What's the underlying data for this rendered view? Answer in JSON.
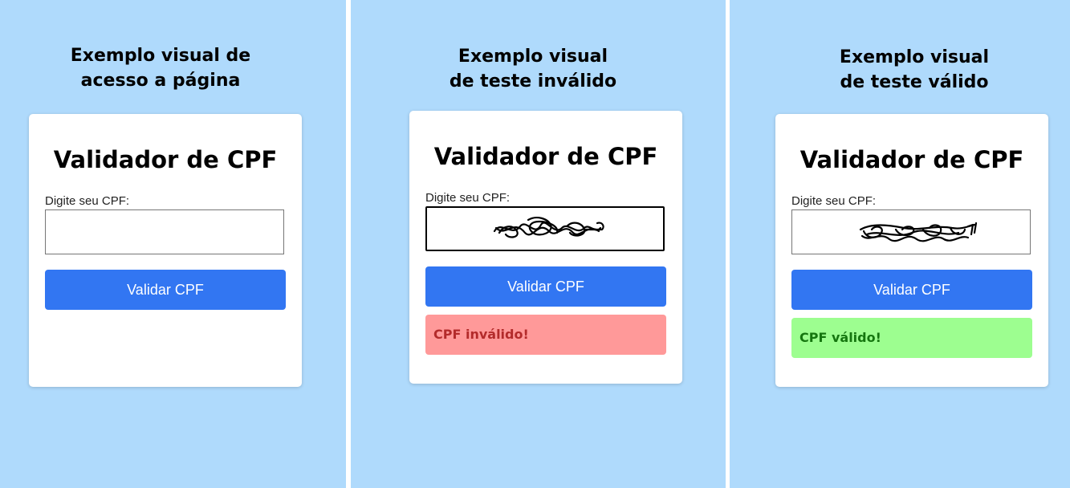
{
  "panels": [
    {
      "caption_lines": [
        "Exemplo visual de",
        "acesso a página"
      ],
      "card": {
        "title": "Validador de CPF",
        "label": "Digite seu CPF:",
        "input_value": "",
        "button_label": "Validar CPF"
      }
    },
    {
      "caption_lines": [
        "Exemplo visual",
        "de teste inválido"
      ],
      "card": {
        "title": "Validador de CPF",
        "label": "Digite seu CPF:",
        "input_value": "",
        "button_label": "Validar CPF",
        "result_text": "CPF inválido!"
      }
    },
    {
      "caption_lines": [
        "Exemplo visual",
        "de teste válido"
      ],
      "card": {
        "title": "Validador de CPF",
        "label": "Digite seu CPF:",
        "input_value": "",
        "button_label": "Validar CPF",
        "result_text": "CPF válido!"
      }
    }
  ],
  "colors": {
    "background": "#afdafc",
    "button": "#3276f2",
    "invalid_bg": "#ff9999",
    "invalid_text": "#b32b2b",
    "valid_bg": "#9dfe90",
    "valid_text": "#15760f"
  }
}
